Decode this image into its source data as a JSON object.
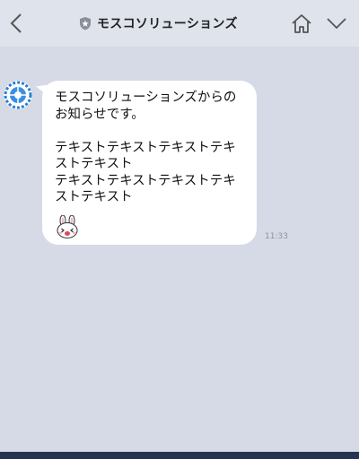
{
  "header": {
    "title": "モスコソリューションズ",
    "back_icon": "chevron-left-icon",
    "shield_icon": "shield-star-icon",
    "home_icon": "home-icon",
    "menu_icon": "chevron-down-icon"
  },
  "message": {
    "text": "モスコソリューションズからの\nお知らせです。\n\nテキストテキストテキストテキ\nストテキスト\nテキストテキストテキストテキ\nストテキスト",
    "time": "11:33",
    "sticker_icon": "bunny-sticker-icon"
  },
  "colors": {
    "background": "#d6dae6",
    "header": "#dfe3ec",
    "bubble": "#ffffff",
    "bottom_bar": "#26354f"
  }
}
